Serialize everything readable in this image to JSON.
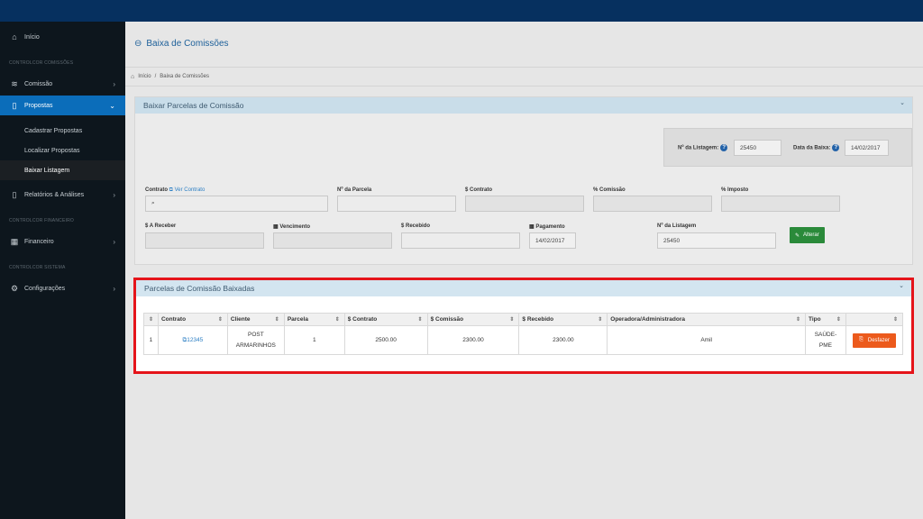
{
  "sidebar": {
    "inicio": "Início",
    "section_comissoes": "CONTROLCOR COMISSÕES",
    "comissao": "Comissão",
    "propostas": "Propostas",
    "cadastrar": "Cadastrar Propostas",
    "localizar": "Localizar Propostas",
    "baixar": "Baixar Listagem",
    "relatorios": "Relatórios & Análises",
    "section_financeiro": "CONTROLCOR FINANCEIRO",
    "financeiro": "Financeiro",
    "section_sistema": "CONTROLCOR SISTEMA",
    "configuracoes": "Configurações"
  },
  "page": {
    "title": "Baixa de Comissões",
    "breadcrumb_home": "Início",
    "breadcrumb_sep": "/",
    "breadcrumb_current": "Baixa de Comissões"
  },
  "form": {
    "panel_title": "Baixar Parcelas de Comissão",
    "num_listagem_label": "Nº da Listagem:",
    "num_listagem_value": "25450",
    "data_baixa_label": "Data da Baixa:",
    "data_baixa_value": "14/02/2017",
    "contrato_label": "Contrato",
    "ver_contrato": "Ver Contrato",
    "num_parcela_label": "Nº da Parcela",
    "valor_contrato_label": "$ Contrato",
    "pct_comissao_label": "% Comissão",
    "pct_imposto_label": "% Imposto",
    "a_receber_label": "$ A Receber",
    "vencimento_label": "Vencimento",
    "recebido_label": "$ Recebido",
    "pagamento_label": "Pagamento",
    "pagamento_value": "14/02/2017",
    "listagem_label": "Nº da Listagem",
    "listagem_value": "25450",
    "alterar": "Alterar"
  },
  "baixadas": {
    "panel_title": "Parcelas de Comissão Baixadas",
    "headers": [
      "Contrato",
      "Cliente",
      "Parcela",
      "$ Contrato",
      "$ Comissão",
      "$ Recebido",
      "Operadora/Administradora",
      "Tipo"
    ],
    "row": {
      "index": "1",
      "contrato": "12345",
      "cliente_l1": "POST",
      "cliente_l2": "ARMARINHOS",
      "parcela": "1",
      "valor_contrato": "2500.00",
      "comissao": "2300.00",
      "recebido": "2300.00",
      "operadora": "Amil",
      "tipo_l1": "SAÚDE-",
      "tipo_l2": "PME",
      "desfazer": "Desfazer"
    }
  },
  "colors": {
    "topbar": "#06305f",
    "sidebar": "#0d161d",
    "active": "#0b6dba",
    "panel_header": "#c9dde9",
    "highlight_border": "#e5141a",
    "desfazer": "#ec5a1c",
    "alterar": "#2a8a3a"
  }
}
